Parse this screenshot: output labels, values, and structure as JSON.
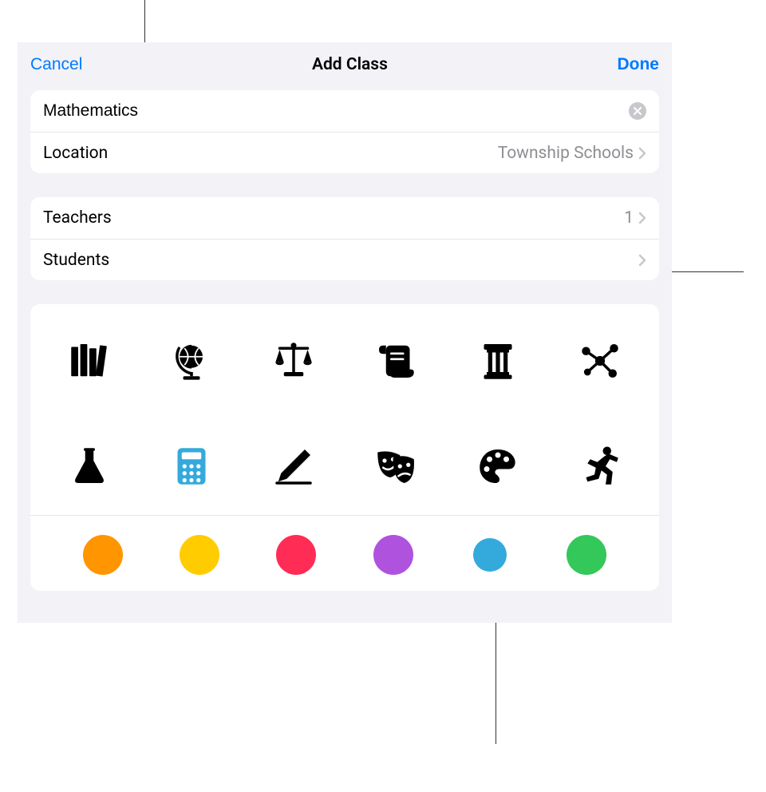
{
  "nav": {
    "cancel": "Cancel",
    "title": "Add Class",
    "done": "Done"
  },
  "class_info": {
    "name_value": "Mathematics",
    "location_label": "Location",
    "location_value": "Township Schools"
  },
  "people": {
    "teachers_label": "Teachers",
    "teachers_count": "1",
    "students_label": "Students",
    "students_count": ""
  },
  "icons": [
    {
      "name": "books-icon",
      "selected": false
    },
    {
      "name": "globe-icon",
      "selected": false
    },
    {
      "name": "scales-icon",
      "selected": false
    },
    {
      "name": "scroll-icon",
      "selected": false
    },
    {
      "name": "column-icon",
      "selected": false
    },
    {
      "name": "molecule-icon",
      "selected": false
    },
    {
      "name": "flask-icon",
      "selected": false
    },
    {
      "name": "calculator-icon",
      "selected": true
    },
    {
      "name": "pencil-icon",
      "selected": false
    },
    {
      "name": "drama-masks-icon",
      "selected": false
    },
    {
      "name": "palette-icon",
      "selected": false
    },
    {
      "name": "running-icon",
      "selected": false
    }
  ],
  "colors": [
    {
      "name": "orange",
      "hex": "#ff9500",
      "selected": false
    },
    {
      "name": "yellow",
      "hex": "#ffcc00",
      "selected": false
    },
    {
      "name": "pink",
      "hex": "#ff2d55",
      "selected": false
    },
    {
      "name": "purple",
      "hex": "#af52de",
      "selected": false
    },
    {
      "name": "blue",
      "hex": "#34aadc",
      "selected": true
    },
    {
      "name": "green",
      "hex": "#34c759",
      "selected": false
    }
  ]
}
